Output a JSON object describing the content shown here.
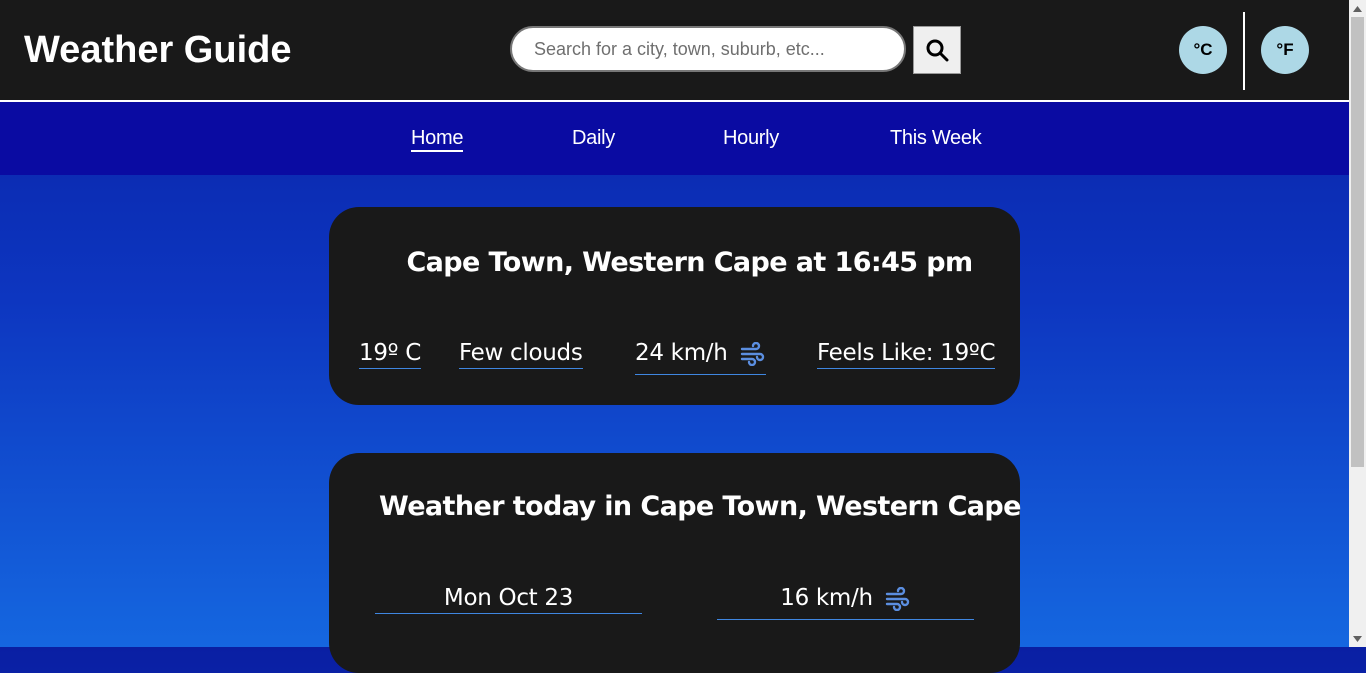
{
  "header": {
    "brand": "Weather Guide",
    "search_placeholder": "Search for a city, town, suburb, etc...",
    "search_value": "",
    "units": {
      "celsius": "°C",
      "fahrenheit": "°F"
    }
  },
  "nav": {
    "items": [
      {
        "label": "Home",
        "active": true
      },
      {
        "label": "Daily"
      },
      {
        "label": "Hourly"
      },
      {
        "label": "This Week"
      }
    ]
  },
  "current": {
    "title": "Cape Town,  Western Cape at 16:45 pm",
    "temperature": "19º C",
    "condition": "Few clouds",
    "wind": "24 km/h",
    "feels_like": "Feels Like: 19ºC"
  },
  "today": {
    "title": "Weather today in Cape Town, Western Cape",
    "date": "Mon Oct 23",
    "wind": "16 km/h"
  },
  "colors": {
    "header_bg": "#191919",
    "nav_bg": "#0a0ba2",
    "card_bg": "#191919",
    "unit_button_bg": "#add8e6",
    "underline_accent": "#3f86e0",
    "wind_icon": "#5b8ee0"
  },
  "icons": {
    "search": "search-icon",
    "wind": "wind-icon"
  }
}
